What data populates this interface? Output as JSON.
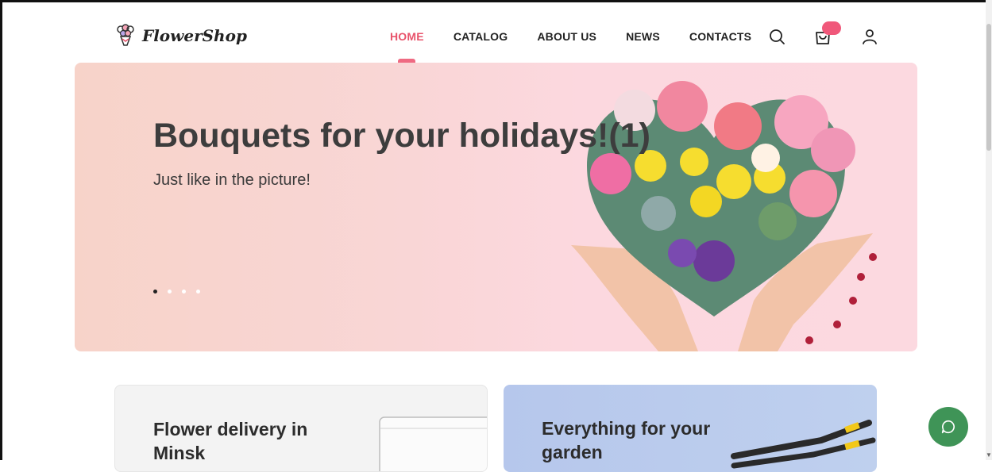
{
  "brand": {
    "name": "FlowerShop",
    "icon": "bouquet-logo-icon"
  },
  "nav": {
    "items": [
      {
        "label": "HOME",
        "active": true
      },
      {
        "label": "CATALOG",
        "active": false
      },
      {
        "label": "ABOUT US",
        "active": false
      },
      {
        "label": "NEWS",
        "active": false
      },
      {
        "label": "CONTACTS",
        "active": false
      }
    ]
  },
  "header_icons": [
    "search-icon",
    "cart-icon",
    "user-icon"
  ],
  "hero": {
    "title": "Bouquets for your holidays!(1)",
    "subtitle": "Just like in the picture!",
    "slides_count": 4,
    "active_slide": 1
  },
  "cards": [
    {
      "title": "Flower delivery in Minsk"
    },
    {
      "title": "Everything for your garden"
    }
  ],
  "colors": {
    "accent": "#e8536b",
    "chat": "#3f9457"
  }
}
